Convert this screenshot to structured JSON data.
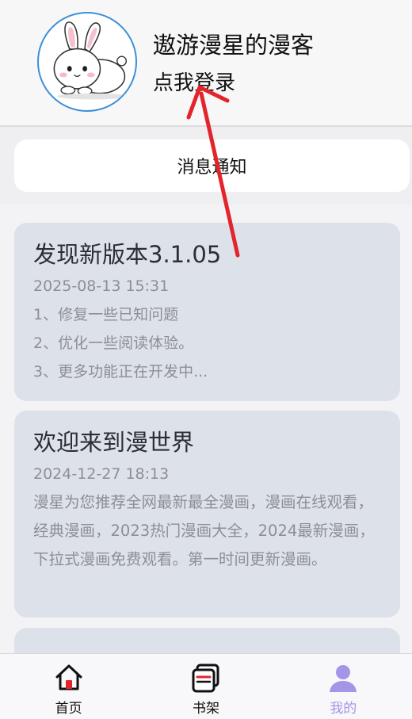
{
  "profile": {
    "username": "遨游漫星的漫客",
    "login_label": "点我登录"
  },
  "notice": {
    "label": "消息通知"
  },
  "messages": [
    {
      "title": "发现新版本3.1.05",
      "date": "2025-08-13 15:31",
      "lines": [
        "1、修复一些已知问题",
        "2、优化一些阅读体验。",
        "3、更多功能正在开发中..."
      ]
    },
    {
      "title": "欢迎来到漫世界",
      "date": "2024-12-27 18:13",
      "body": "漫星为您推荐全网最新最全漫画，漫画在线观看，经典漫画，2023热门漫画大全，2024最新漫画，下拉式漫画免费观看。第一时间更新漫画。"
    }
  ],
  "nav": {
    "items": [
      {
        "label": "首页",
        "icon": "home-icon"
      },
      {
        "label": "书架",
        "icon": "bookshelf-icon"
      },
      {
        "label": "我的",
        "icon": "user-icon",
        "active": true
      }
    ]
  },
  "colors": {
    "accent": "#a495e6",
    "card_bg": "#dde2ea",
    "avatar_border": "#3d8fd8",
    "annotation": "#e3242b"
  }
}
